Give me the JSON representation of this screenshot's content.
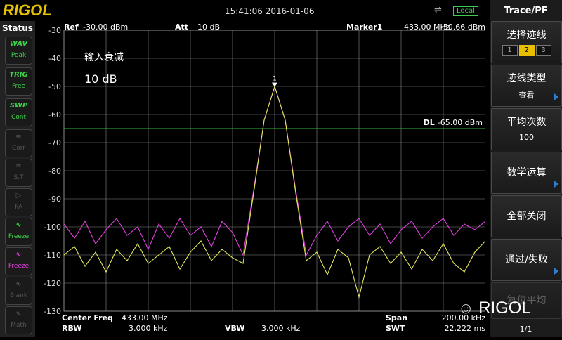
{
  "brand": "RIGOL",
  "datetime": "15:41:06 2016-01-06",
  "usb_icon": "usb-icon",
  "local_label": "Local",
  "status": {
    "title": "Status",
    "items": [
      {
        "icon": "WAV",
        "label": "Peak",
        "state": "on"
      },
      {
        "icon": "TRIG",
        "label": "Free",
        "state": "on"
      },
      {
        "icon": "SWP",
        "label": "Cont",
        "state": "on"
      },
      {
        "icon": "≈",
        "label": "Corr",
        "state": "off"
      },
      {
        "icon": "≈",
        "label": "S.T",
        "state": "off"
      },
      {
        "icon": "▷",
        "label": "PA",
        "state": "off"
      },
      {
        "icon": "∿",
        "label": "Freeze",
        "state": "on"
      },
      {
        "icon": "∿",
        "label": "Freeze",
        "state": "mag"
      },
      {
        "icon": "∿",
        "label": "Blank",
        "state": "off"
      },
      {
        "icon": "∿",
        "label": "Math",
        "state": "off"
      }
    ]
  },
  "header": {
    "ref_label": "Ref",
    "ref_value": "-30.00 dBm",
    "att_label": "Att",
    "att_value": "10 dB",
    "marker_label": "Marker1",
    "marker_freq": "433.00 MHz",
    "marker_amp": "-50.66 dBm"
  },
  "annotation": {
    "line1": "输入衰减",
    "line2": "10 dB"
  },
  "display_line": {
    "label": "DL",
    "value": "-65.00 dBm"
  },
  "marker_number": "1",
  "footer": {
    "center_freq_label": "Center Freq",
    "center_freq_value": "433.00 MHz",
    "span_label": "Span",
    "span_value": "200.00 kHz",
    "rbw_label": "RBW",
    "rbw_value": "3.000 kHz",
    "vbw_label": "VBW",
    "vbw_value": "3.000 kHz",
    "swt_label": "SWT",
    "swt_value": "22.222 ms"
  },
  "menu": {
    "title": "Trace/PF",
    "keys": [
      {
        "label": "选择迹线",
        "value": ""
      },
      {
        "label": "迹线类型",
        "value": "查看"
      },
      {
        "label": "平均次数",
        "value": "100"
      },
      {
        "label": "数学运算",
        "value": ""
      },
      {
        "label": "全部关闭",
        "value": ""
      },
      {
        "label": "通过/失败",
        "value": ""
      },
      {
        "label": "复位平均",
        "value": ""
      }
    ],
    "trace_select": [
      "1",
      "2",
      "3"
    ],
    "trace_selected": "2",
    "page": "1/1"
  },
  "watermark": "RIGOL",
  "colors": {
    "grid": "#8a8a8a",
    "trace_active": "#e040e0",
    "trace_frozen": "#e6e65c",
    "display_line": "#33b833",
    "marker": "#ffffff",
    "status_on": "#3dd34a",
    "logo": "#e6c200",
    "selected": "#e8c000"
  },
  "chart_data": {
    "type": "line",
    "xlabel": "",
    "ylabel": "",
    "ylim": [
      -130,
      -30
    ],
    "yticks": [
      -30,
      -40,
      -50,
      -60,
      -70,
      -80,
      -90,
      -100,
      -110,
      -120,
      -130
    ],
    "x_center_mhz": 433.0,
    "x_span_khz": 200.0,
    "xlim_mhz": [
      432.9,
      433.1
    ],
    "grid": true,
    "series": [
      {
        "color": "#e040e0",
        "x": [
          432.9,
          432.905,
          432.91,
          432.915,
          432.92,
          432.925,
          432.93,
          432.935,
          432.94,
          432.945,
          432.95,
          432.955,
          432.96,
          432.965,
          432.97,
          432.975,
          432.98,
          432.985,
          432.99,
          432.995,
          433.0,
          433.005,
          433.01,
          433.015,
          433.02,
          433.025,
          433.03,
          433.035,
          433.04,
          433.045,
          433.05,
          433.055,
          433.06,
          433.065,
          433.07,
          433.075,
          433.08,
          433.085,
          433.09,
          433.095,
          433.1
        ],
        "y": [
          -99,
          -104,
          -98,
          -106,
          -101,
          -97,
          -103,
          -100,
          -108,
          -99,
          -104,
          -97,
          -103,
          -100,
          -107,
          -98,
          -102,
          -110,
          -87,
          -62,
          -50,
          -62,
          -87,
          -110,
          -103,
          -98,
          -105,
          -100,
          -97,
          -103,
          -99,
          -106,
          -101,
          -98,
          -104,
          -100,
          -97,
          -103,
          -99,
          -101,
          -98
        ]
      },
      {
        "color": "#e6e65c",
        "x": [
          432.9,
          432.905,
          432.91,
          432.915,
          432.92,
          432.925,
          432.93,
          432.935,
          432.94,
          432.945,
          432.95,
          432.955,
          432.96,
          432.965,
          432.97,
          432.975,
          432.98,
          432.985,
          432.99,
          432.995,
          433.0,
          433.005,
          433.01,
          433.015,
          433.02,
          433.025,
          433.03,
          433.035,
          433.04,
          433.045,
          433.05,
          433.055,
          433.06,
          433.065,
          433.07,
          433.075,
          433.08,
          433.085,
          433.09,
          433.095,
          433.1
        ],
        "y": [
          -110,
          -107,
          -114,
          -109,
          -116,
          -108,
          -112,
          -106,
          -113,
          -110,
          -107,
          -115,
          -109,
          -105,
          -112,
          -108,
          -111,
          -113,
          -88,
          -62,
          -50,
          -62,
          -88,
          -112,
          -109,
          -117,
          -108,
          -111,
          -125,
          -110,
          -107,
          -113,
          -109,
          -115,
          -108,
          -112,
          -106,
          -113,
          -116,
          -109,
          -105
        ]
      }
    ],
    "display_line": -65,
    "marker": {
      "x": 433.0,
      "y": -50.66
    }
  }
}
